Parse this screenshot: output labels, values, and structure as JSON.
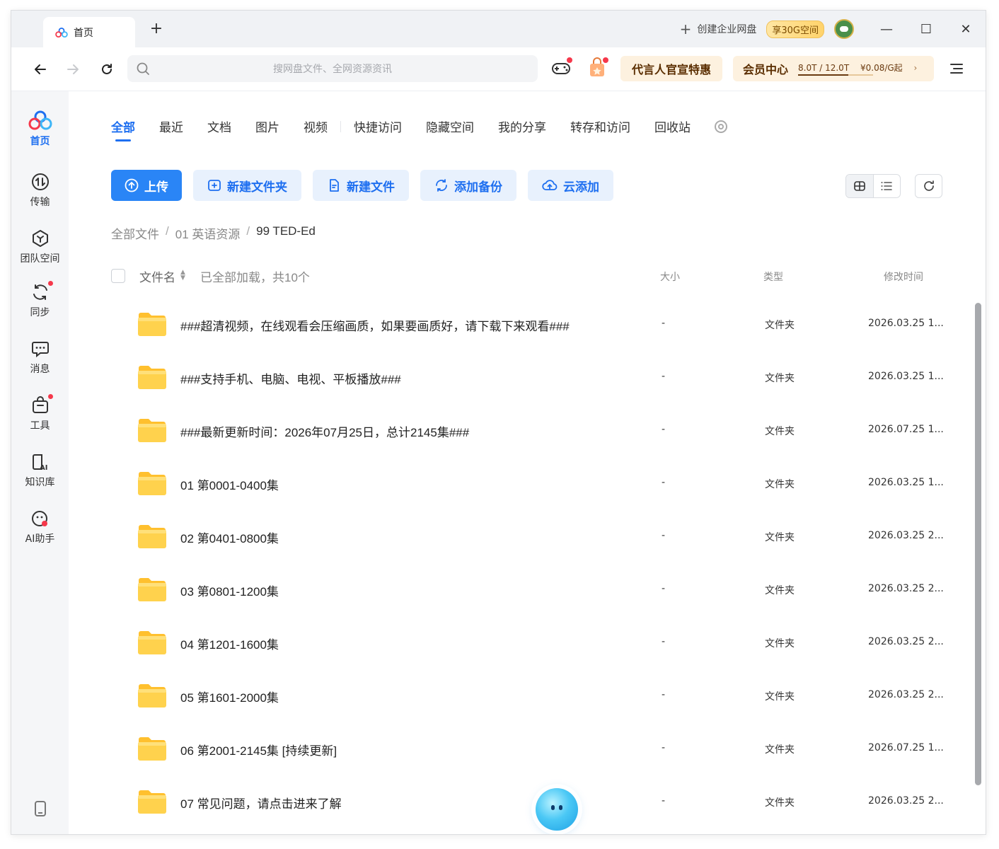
{
  "titlebar": {
    "tab_label": "首页",
    "new_tab": "+",
    "create_enterprise": "创建企业网盘",
    "badge": "享30G空间",
    "minimize": "—",
    "maximize": "☐",
    "close": "✕"
  },
  "navbar": {
    "search_placeholder": "搜网盘文件、全网资源资讯",
    "promo": "代言人官宣特惠",
    "vip_label": "会员中心",
    "storage": "8.0T / 12.0T",
    "storage_fraction": 0.667,
    "price": "¥0.08/G起",
    "vip_arrow": "›"
  },
  "sidebar": {
    "items": [
      {
        "label": "首页",
        "icon": "home-logo-icon"
      },
      {
        "label": "传输",
        "icon": "transfer-icon"
      },
      {
        "label": "团队空间",
        "icon": "team-space-icon"
      },
      {
        "label": "同步",
        "icon": "sync-icon"
      },
      {
        "label": "消息",
        "icon": "message-icon"
      },
      {
        "label": "工具",
        "icon": "tools-icon"
      },
      {
        "label": "知识库",
        "icon": "knowledge-base-icon"
      },
      {
        "label": "AI助手",
        "icon": "ai-assistant-icon"
      }
    ]
  },
  "categories": {
    "tabs": [
      "全部",
      "最近",
      "文档",
      "图片",
      "视频",
      "快捷访问",
      "隐藏空间",
      "我的分享",
      "转存和访问",
      "回收站"
    ]
  },
  "actions": {
    "upload": "上传",
    "new_folder": "新建文件夹",
    "new_file": "新建文件",
    "add_backup": "添加备份",
    "cloud_add": "云添加"
  },
  "breadcrumb": {
    "items": [
      "全部文件",
      "01 英语资源",
      "99 TED-Ed"
    ],
    "separator": "/"
  },
  "table": {
    "col_name": "文件名",
    "loaded_status": "已全部加载，共10个",
    "col_size": "大小",
    "col_type": "类型",
    "col_mtime": "修改时间",
    "rows": [
      {
        "name": "###超清视频，在线观看会压缩画质，如果要画质好，请下载下来观看###",
        "size": "-",
        "type": "文件夹",
        "mtime": "2026.03.25 1..."
      },
      {
        "name": "###支持手机、电脑、电视、平板播放###",
        "size": "-",
        "type": "文件夹",
        "mtime": "2026.03.25 1..."
      },
      {
        "name": "###最新更新时间：2026年07月25日，总计2145集###",
        "size": "-",
        "type": "文件夹",
        "mtime": "2026.07.25 1..."
      },
      {
        "name": "01 第0001-0400集",
        "size": "-",
        "type": "文件夹",
        "mtime": "2026.03.25 1..."
      },
      {
        "name": "02 第0401-0800集",
        "size": "-",
        "type": "文件夹",
        "mtime": "2026.03.25 2..."
      },
      {
        "name": "03 第0801-1200集",
        "size": "-",
        "type": "文件夹",
        "mtime": "2026.03.25 2..."
      },
      {
        "name": "04 第1201-1600集",
        "size": "-",
        "type": "文件夹",
        "mtime": "2026.03.25 2..."
      },
      {
        "name": "05 第1601-2000集",
        "size": "-",
        "type": "文件夹",
        "mtime": "2026.03.25 2..."
      },
      {
        "name": "06 第2001-2145集 [持续更新]",
        "size": "-",
        "type": "文件夹",
        "mtime": "2026.07.25 1..."
      },
      {
        "name": "07 常见问题，请点击进来了解",
        "size": "-",
        "type": "文件夹",
        "mtime": "2026.03.25 2..."
      }
    ]
  },
  "colors": {
    "accent": "#1e6ff0",
    "primary_button": "#2a85f6",
    "folder": "#ffc933",
    "badge_dot": "#f5384b"
  }
}
